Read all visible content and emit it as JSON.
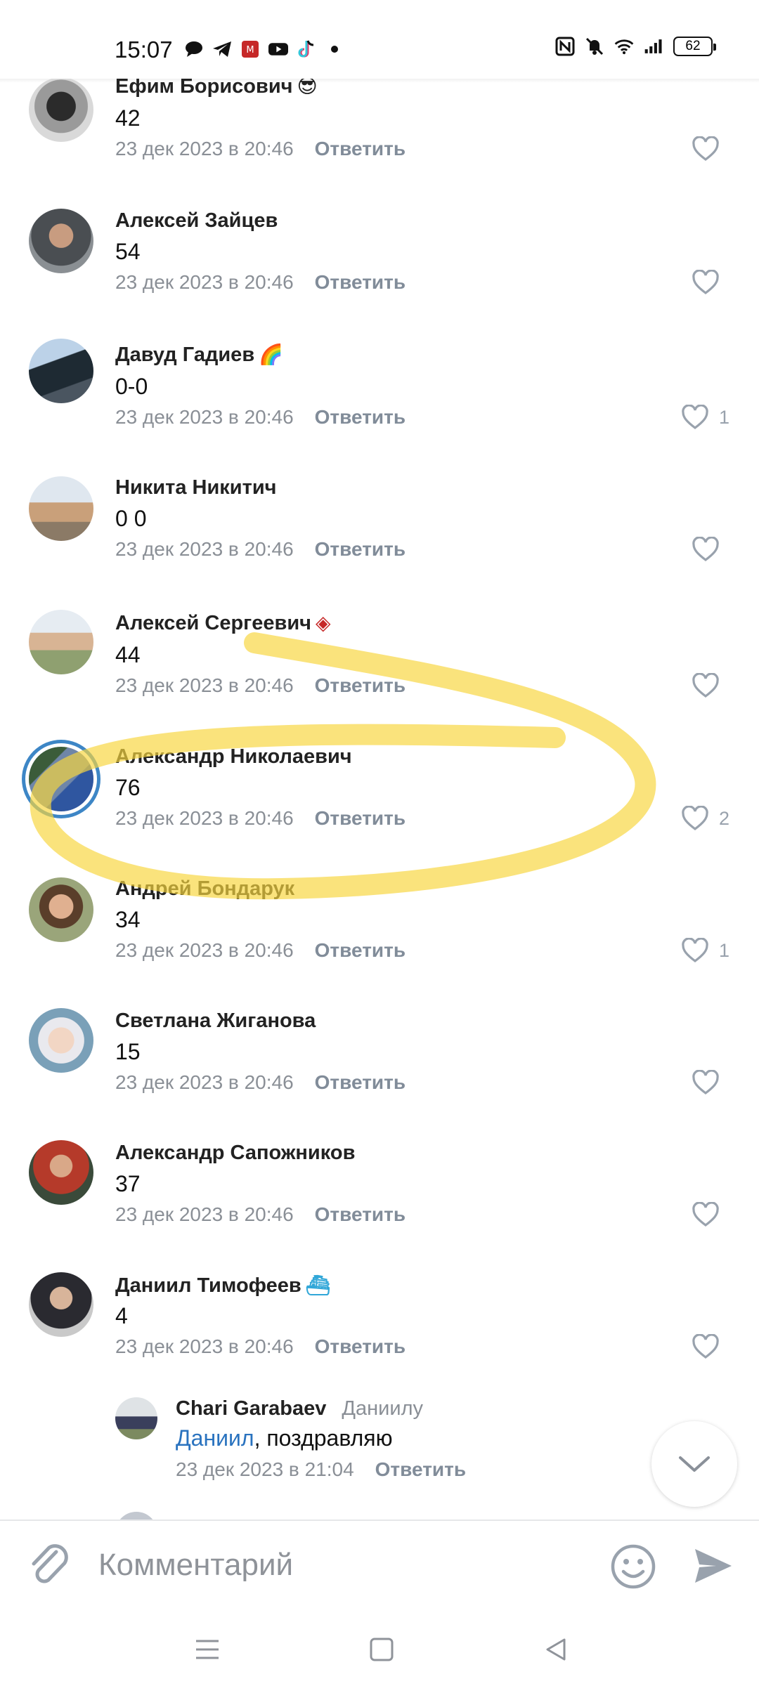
{
  "status_bar": {
    "time": "15:07",
    "battery": "62",
    "left_icons": [
      "chat-bubble-icon",
      "telegram-icon",
      "app-icon",
      "youtube-icon",
      "tiktok-icon",
      "dot-icon"
    ],
    "right_icons": [
      "nfc-icon",
      "mute-bell-icon",
      "wifi-icon",
      "signal-icon",
      "battery-icon"
    ]
  },
  "reply_label": "Ответить",
  "comments": [
    {
      "name": "Ефим Борисович",
      "emoji": "😎",
      "text": "42",
      "time": "23 дек 2023 в 20:46",
      "likes": "",
      "reply": "Ответить"
    },
    {
      "name": "Алексей Зайцев",
      "emoji": "",
      "text": "54",
      "time": "23 дек 2023 в 20:46",
      "likes": "",
      "reply": "Ответить"
    },
    {
      "name": "Давуд Гадиев",
      "emoji": "🌈",
      "text": "0-0",
      "time": "23 дек 2023 в 20:46",
      "likes": "1",
      "reply": "Ответить"
    },
    {
      "name": "Никита Никитич",
      "emoji": "",
      "text": "0 0",
      "time": "23 дек 2023 в 20:46",
      "likes": "",
      "reply": "Ответить"
    },
    {
      "name": "Алексей Сергеевич",
      "emoji": "◈",
      "text": "44",
      "time": "23 дек 2023 в 20:46",
      "likes": "",
      "reply": "Ответить"
    },
    {
      "name": "Александр Николаевич",
      "emoji": "",
      "text": "76",
      "time": "23 дек 2023 в 20:46",
      "likes": "2",
      "reply": "Ответить"
    },
    {
      "name": "Андрей Бондарук",
      "emoji": "",
      "text": "34",
      "time": "23 дек 2023 в 20:46",
      "likes": "1",
      "reply": "Ответить"
    },
    {
      "name": "Светлана Жиганова",
      "emoji": "",
      "text": "15",
      "time": "23 дек 2023 в 20:46",
      "likes": "",
      "reply": "Ответить"
    },
    {
      "name": "Александр Сапожников",
      "emoji": "",
      "text": "37",
      "time": "23 дек 2023 в 20:46",
      "likes": "",
      "reply": "Ответить"
    },
    {
      "name": "Даниил Тимофеев",
      "emoji": "⛴",
      "text": "4",
      "time": "23 дек 2023 в 20:46",
      "likes": "",
      "reply": "Ответить"
    }
  ],
  "nested_reply": {
    "name": "Chari Garabaev",
    "to_whom": "Даниилу",
    "mention": "Даниил",
    "text": ", поздравляю",
    "time": "23 дек 2023 в 21:04",
    "reply": "Ответить"
  },
  "composer": {
    "placeholder": "Комментарий"
  },
  "colors": {
    "accent": "#2a73bf",
    "highlight": "#f7d53e",
    "meta": "#8a8f96",
    "heart": "#99a2ad"
  }
}
